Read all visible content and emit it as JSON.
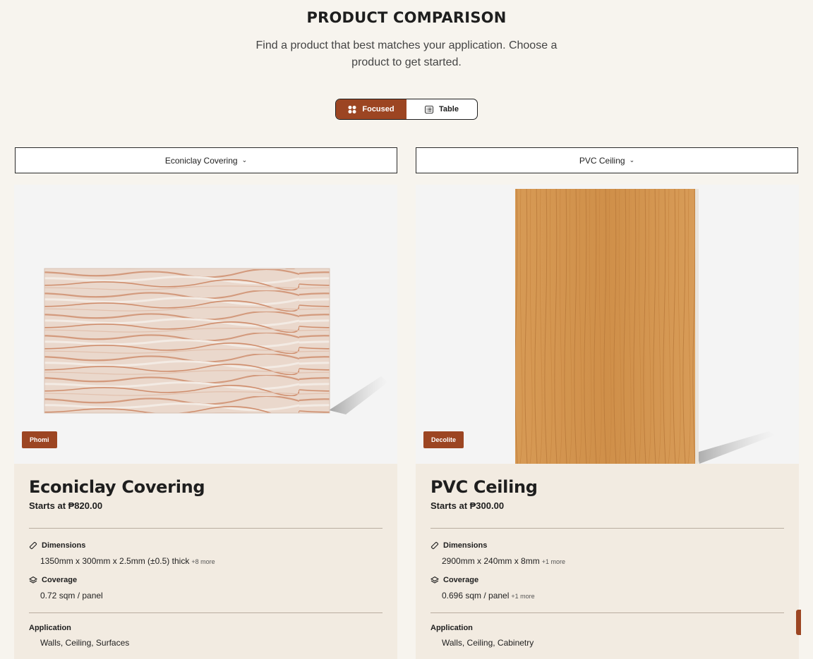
{
  "header": {
    "title": "PRODUCT COMPARISON",
    "subtitle": "Find a product that best matches your application. Choose a product to get started."
  },
  "view_toggle": {
    "focused_label": "Focused",
    "table_label": "Table",
    "active": "Focused"
  },
  "colors": {
    "accent": "#9c4522",
    "background": "#f7f4ee",
    "card": "#f2ebe1"
  },
  "products": [
    {
      "select_label": "Econiclay Covering",
      "brand": "Phomi",
      "name": "Econiclay Covering",
      "price": "Starts at ₱820.00",
      "dimensions_label": "Dimensions",
      "dimensions": "1350mm x 300mm x 2.5mm (±0.5) thick",
      "dimensions_more": "+8 more",
      "coverage_label": "Coverage",
      "coverage": "0.72 sqm / panel",
      "coverage_more": "",
      "application_label": "Application",
      "application": "Walls, Ceiling, Surfaces"
    },
    {
      "select_label": "PVC Ceiling",
      "brand": "Decolite",
      "name": "PVC Ceiling",
      "price": "Starts at ₱300.00",
      "dimensions_label": "Dimensions",
      "dimensions": "2900mm x 240mm x 8mm",
      "dimensions_more": "+1 more",
      "coverage_label": "Coverage",
      "coverage": "0.696 sqm / panel",
      "coverage_more": "+1 more",
      "application_label": "Application",
      "application": "Walls, Ceiling, Cabinetry"
    }
  ]
}
